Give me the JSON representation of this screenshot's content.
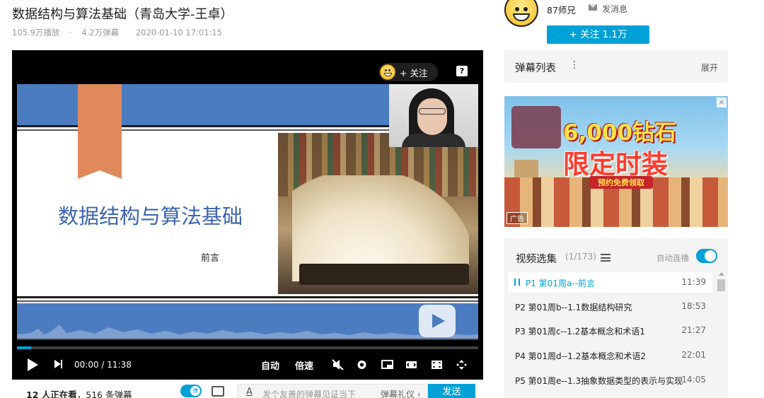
{
  "video": {
    "title": "数据结构与算法基础（青岛大学-王卓）",
    "plays": "105.9万播放",
    "separator": "·",
    "danmaku_count": "4.2万弹幕",
    "date": "2020-01-10 17:01:15"
  },
  "player": {
    "follow_overlay": "+ 关注",
    "help_icon": "?",
    "slide": {
      "title": "数据结构与算法基础",
      "subtitle": "前言"
    },
    "time_current": "00:00",
    "time_sep": "/",
    "time_total": "11:38",
    "progress": 0.03,
    "auto_label": "自动",
    "speed_label": "倍速"
  },
  "under_player": {
    "viewers": "12 人正在看",
    "danmaku_loaded": "516 条弹幕",
    "viewers_sep": "，",
    "dm_toggle_label": "弹",
    "input_placeholder": "发个友善的弹幕见证当下",
    "input_font_icon": "A",
    "etiquette_link": "弹幕礼仪 ›",
    "send_label": "发送"
  },
  "uploader": {
    "name": "87师兄",
    "message_label": "发消息",
    "follow_label": "+ 关注 1.1万"
  },
  "danmaku_panel": {
    "label": "弹幕列表",
    "menu_icon": "⋮",
    "expand_label": "展开"
  },
  "ad": {
    "headline": "6,000钻石",
    "headline2": "限定时装",
    "sub": "预约免费领取",
    "tag": "广告",
    "close": "×"
  },
  "playlist": {
    "title": "视频选集",
    "count": "(1/173)",
    "autoplay_label": "自动连播",
    "autoplay_on": true,
    "episodes": [
      {
        "title": "P1  第01周a--前言",
        "duration": "11:39",
        "active": true
      },
      {
        "title": "P2  第01周b--1.1数据结构研究",
        "duration": "18:53",
        "active": false
      },
      {
        "title": "P3  第01周c--1.2基本概念和术语1",
        "duration": "21:27",
        "active": false
      },
      {
        "title": "P4  第01周d--1.2基本概念和术语2",
        "duration": "22:01",
        "active": false
      },
      {
        "title": "P5  第01周e--1.3抽象数据类型的表示与实现",
        "duration": "14:05",
        "active": false
      }
    ]
  },
  "colors": {
    "accent": "#00a1d6",
    "slide_blue": "#4c7cc0",
    "ribbon": "#e0895b"
  }
}
